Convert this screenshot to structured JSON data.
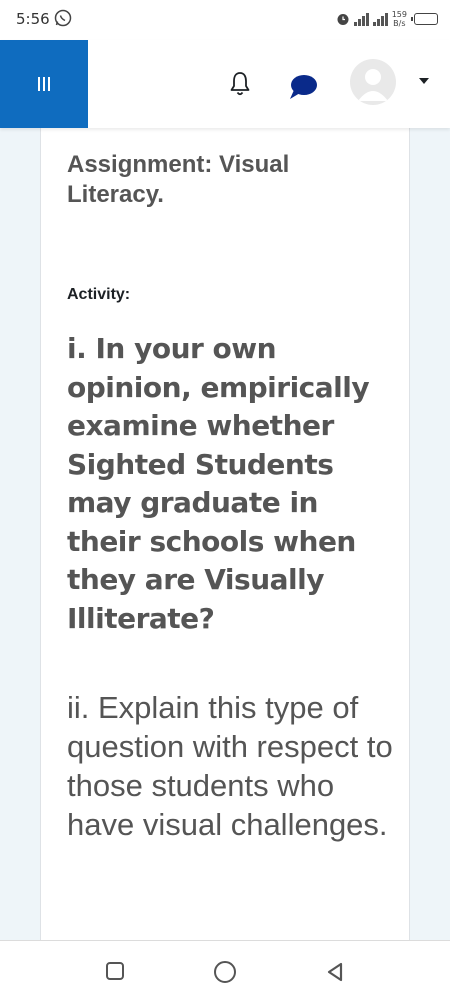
{
  "status_bar": {
    "time": "5:56",
    "network_speed_value": "159",
    "network_speed_unit": "B/s"
  },
  "header": {
    "icons": [
      "hamburger-menu-icon",
      "bell-icon",
      "chat-bubble-icon",
      "avatar-icon",
      "caret-down-icon"
    ]
  },
  "content": {
    "title": "Assignment: Visual Literacy.",
    "activity_label": "Activity:",
    "question_one": "i. In your own opinion, empirically examine whether Sighted Students may graduate in their schools when they are Visually Illiterate?",
    "question_two": "ii. Explain this type of question with respect to those students who have visual challenges."
  },
  "colors": {
    "brand": "#0f6cbf",
    "chat_icon": "#0a2a8a",
    "text": "#555555",
    "page_background": "#eef5f9"
  },
  "nav_bar": {
    "icons": [
      "recent-apps-icon",
      "home-icon",
      "back-icon"
    ]
  }
}
